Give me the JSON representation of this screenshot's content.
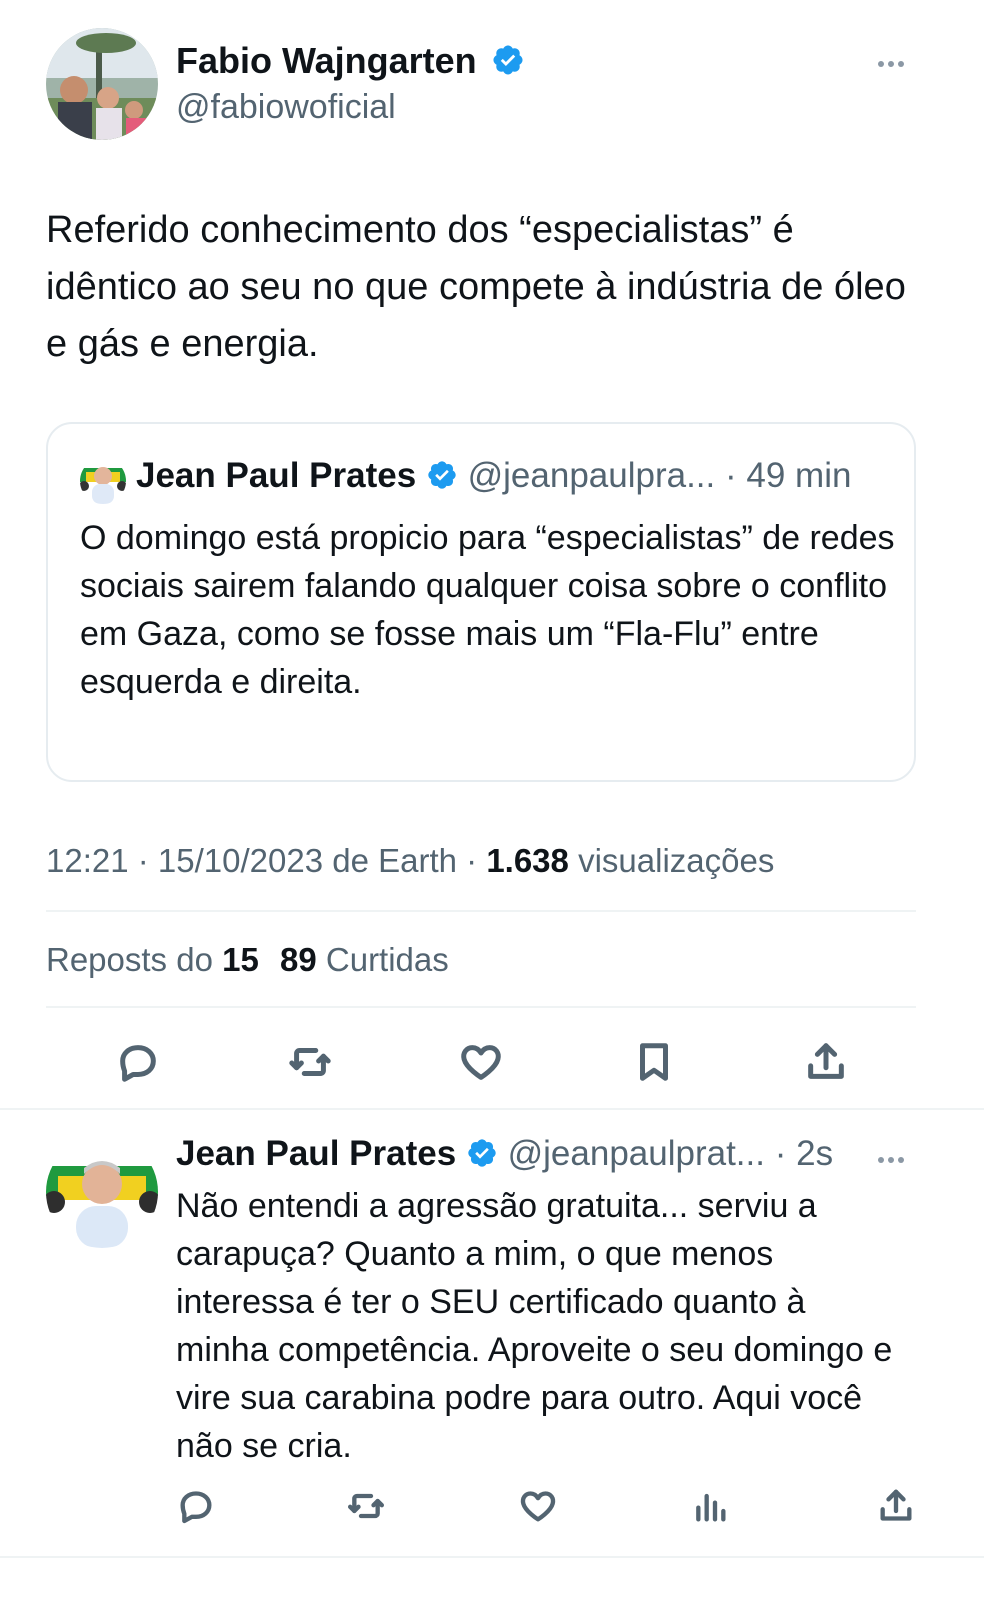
{
  "main_tweet": {
    "author_name": "Fabio Wajngarten",
    "author_handle": "@fabiowoficial",
    "text": "Referido conhecimento dos “especialistas” é idêntico ao seu no que compete à indústria de óleo e gás e energia.",
    "timestamp": "12:21 · 15/10/2023 de Earth · ",
    "views_count": "1.638",
    "views_label": " visualizações",
    "reposts_label": "Reposts do ",
    "reposts_count": "15",
    "likes_count": "89",
    "likes_label": " Curtidas"
  },
  "quoted_tweet": {
    "author_name": "Jean Paul Prates",
    "author_handle": "@jeanpaulpra...",
    "time": "· 49 min",
    "text": "O domingo está propicio para “especialistas” de redes sociais sairem falando qualquer coisa sobre o conflito em Gaza, como se fosse mais um “Fla-Flu” entre esquerda e direita."
  },
  "reply_tweet": {
    "author_name": "Jean Paul Prates",
    "author_handle": "@jeanpaulprat...",
    "time": "· 2s",
    "text": "Não entendi a agressão gratuita... serviu a carapuça? Quanto a mim, o que menos interessa é ter o SEU certificado quanto à minha competência. Aproveite o seu domingo e vire sua carabina podre para outro. Aqui você não se cria."
  },
  "colors": {
    "verified": "#1d9bf0",
    "text": "#0f1419",
    "secondary": "#536471",
    "divider": "#eff3f4"
  },
  "icons": [
    "reply-icon",
    "repost-icon",
    "like-icon",
    "bookmark-icon",
    "share-icon",
    "views-icon",
    "more-icon",
    "verified-badge-icon"
  ]
}
